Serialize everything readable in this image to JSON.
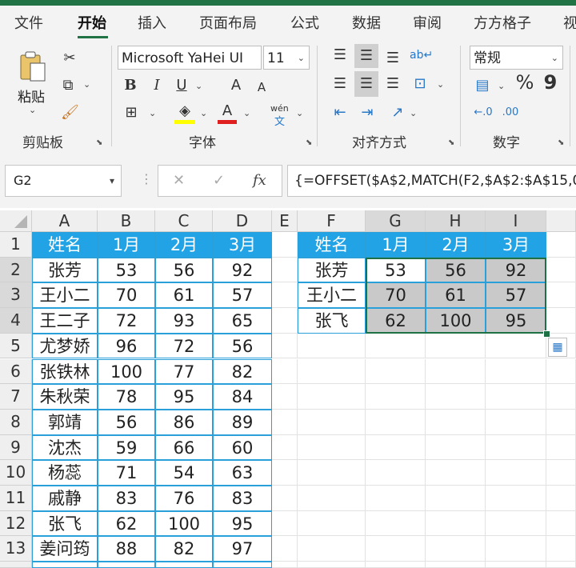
{
  "tabs": [
    {
      "label": "文件",
      "active": false
    },
    {
      "label": "开始",
      "active": true
    },
    {
      "label": "插入",
      "active": false
    },
    {
      "label": "页面布局",
      "active": false
    },
    {
      "label": "公式",
      "active": false
    },
    {
      "label": "数据",
      "active": false
    },
    {
      "label": "审阅",
      "active": false
    },
    {
      "label": "方方格子",
      "active": false
    },
    {
      "label": "视",
      "active": false
    }
  ],
  "ribbon": {
    "clipboard": {
      "paste_label": "粘贴",
      "group_label": "剪贴板"
    },
    "font": {
      "font_name": "Microsoft YaHei UI",
      "font_size": "11",
      "bold": "B",
      "italic": "I",
      "underline": "U",
      "grow": "A",
      "shrink": "A",
      "font_color": "A",
      "phonetic_top": "wén",
      "phonetic_bottom": "文",
      "group_label": "字体"
    },
    "alignment": {
      "group_label": "对齐方式"
    },
    "number": {
      "format": "常规",
      "percent": "%",
      "comma": "9",
      "group_label": "数字"
    }
  },
  "colors": {
    "accent": "#217346",
    "header_fill": "#21a3e6",
    "selection_fill": "#c9c9c9",
    "border_blue": "#2aa0db"
  },
  "formula_bar": {
    "name_box": "G2",
    "cancel": "✕",
    "enter": "✓",
    "fx": "fx",
    "formula": "{=OFFSET($A$2,MATCH(F2,$A$2:$A$15,0"
  },
  "sheet": {
    "columns": [
      "A",
      "B",
      "C",
      "D",
      "E",
      "F",
      "G",
      "H",
      "I"
    ],
    "rows": [
      "1",
      "2",
      "3",
      "4",
      "5",
      "6",
      "7",
      "8",
      "9",
      "10",
      "11",
      "12",
      "13"
    ],
    "left_table": [
      [
        "姓名",
        "1月",
        "2月",
        "3月"
      ],
      [
        "张芳",
        "53",
        "56",
        "92"
      ],
      [
        "王小二",
        "70",
        "61",
        "57"
      ],
      [
        "王二子",
        "72",
        "93",
        "65"
      ],
      [
        "尤梦娇",
        "96",
        "72",
        "56"
      ],
      [
        "张铁林",
        "100",
        "77",
        "82"
      ],
      [
        "朱秋荣",
        "78",
        "95",
        "84"
      ],
      [
        "郭靖",
        "56",
        "86",
        "89"
      ],
      [
        "沈杰",
        "59",
        "66",
        "60"
      ],
      [
        "杨蕊",
        "71",
        "54",
        "63"
      ],
      [
        "戚静",
        "83",
        "76",
        "83"
      ],
      [
        "张飞",
        "62",
        "100",
        "95"
      ],
      [
        "姜问筠",
        "88",
        "82",
        "97"
      ]
    ],
    "right_table": [
      [
        "姓名",
        "1月",
        "2月",
        "3月"
      ],
      [
        "张芳",
        "53",
        "56",
        "92"
      ],
      [
        "王小二",
        "70",
        "61",
        "57"
      ],
      [
        "张飞",
        "62",
        "100",
        "95"
      ]
    ]
  }
}
